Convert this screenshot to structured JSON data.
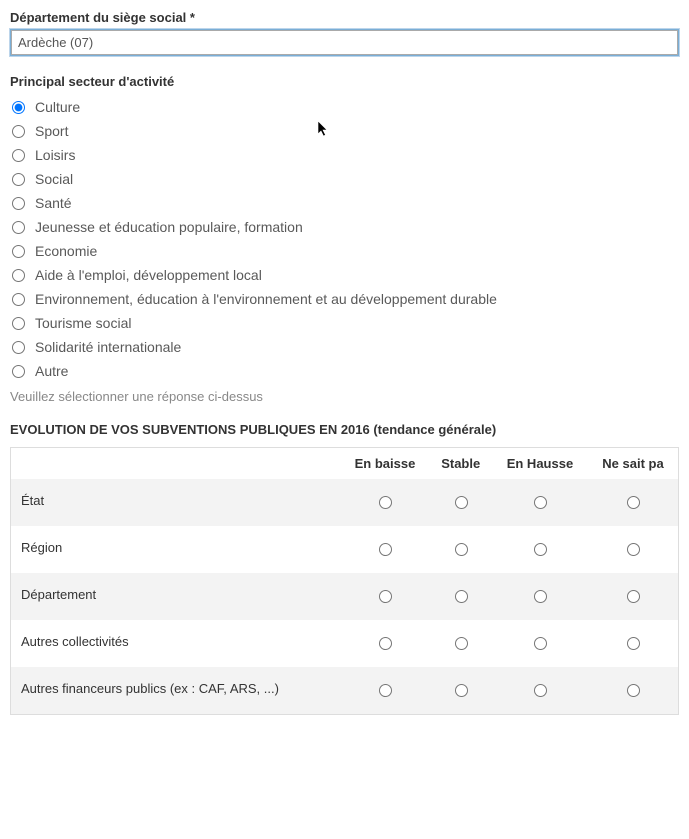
{
  "departement": {
    "label": "Département du siège social *",
    "value": "Ardèche (07)"
  },
  "secteur": {
    "label": "Principal secteur d'activité",
    "options": [
      {
        "key": "culture",
        "label": "Culture",
        "checked": true
      },
      {
        "key": "sport",
        "label": "Sport",
        "checked": false
      },
      {
        "key": "loisirs",
        "label": "Loisirs",
        "checked": false
      },
      {
        "key": "social",
        "label": "Social",
        "checked": false
      },
      {
        "key": "sante",
        "label": "Santé",
        "checked": false
      },
      {
        "key": "jeunesse",
        "label": "Jeunesse et éducation populaire, formation",
        "checked": false
      },
      {
        "key": "economie",
        "label": "Economie",
        "checked": false
      },
      {
        "key": "emploi",
        "label": "Aide à l'emploi, développement local",
        "checked": false
      },
      {
        "key": "environnement",
        "label": "Environnement, éducation à l'environnement et au développement durable",
        "checked": false
      },
      {
        "key": "tourisme",
        "label": "Tourisme social",
        "checked": false
      },
      {
        "key": "solidarite",
        "label": "Solidarité internationale",
        "checked": false
      },
      {
        "key": "autre",
        "label": "Autre",
        "checked": false
      }
    ],
    "hint": "Veuillez sélectionner une réponse ci-dessus"
  },
  "evolution": {
    "heading": "EVOLUTION DE VOS SUBVENTIONS PUBLIQUES EN 2016 (tendance générale)",
    "columns": [
      "En baisse",
      "Stable",
      "En Hausse",
      "Ne sait pa"
    ],
    "rows": [
      {
        "key": "etat",
        "label": "État"
      },
      {
        "key": "region",
        "label": "Région"
      },
      {
        "key": "departement",
        "label": "Département"
      },
      {
        "key": "autres-coll",
        "label": "Autres collectivités"
      },
      {
        "key": "autres-fin",
        "label": "Autres financeurs publics (ex : CAF, ARS, ...)"
      }
    ]
  }
}
